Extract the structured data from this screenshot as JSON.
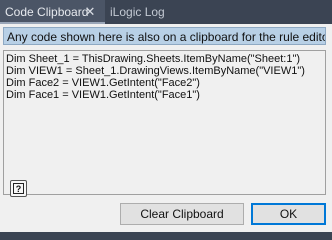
{
  "tabs": [
    {
      "label": "Code Clipboard",
      "close_glyph": "✕",
      "active": true
    },
    {
      "label": "iLogic Log",
      "active": false
    }
  ],
  "info_text": "Any code shown here is also on a clipboard for the rule editor.",
  "code_lines": [
    "Dim Sheet_1 = ThisDrawing.Sheets.ItemByName(\"Sheet:1\")",
    "Dim VIEW1 = Sheet_1.DrawingViews.ItemByName(\"VIEW1\")",
    "Dim Face2 = VIEW1.GetIntent(\"Face2\")",
    "Dim Face1 = VIEW1.GetIntent(\"Face1\")"
  ],
  "help_icon_glyph": "?",
  "buttons": {
    "clear": "Clear Clipboard",
    "ok": "OK"
  },
  "colors": {
    "titlebar": "#3b4453",
    "panel": "#f0f0f0",
    "info_bg": "#b8d0e6",
    "ok_border": "#0078d7"
  }
}
